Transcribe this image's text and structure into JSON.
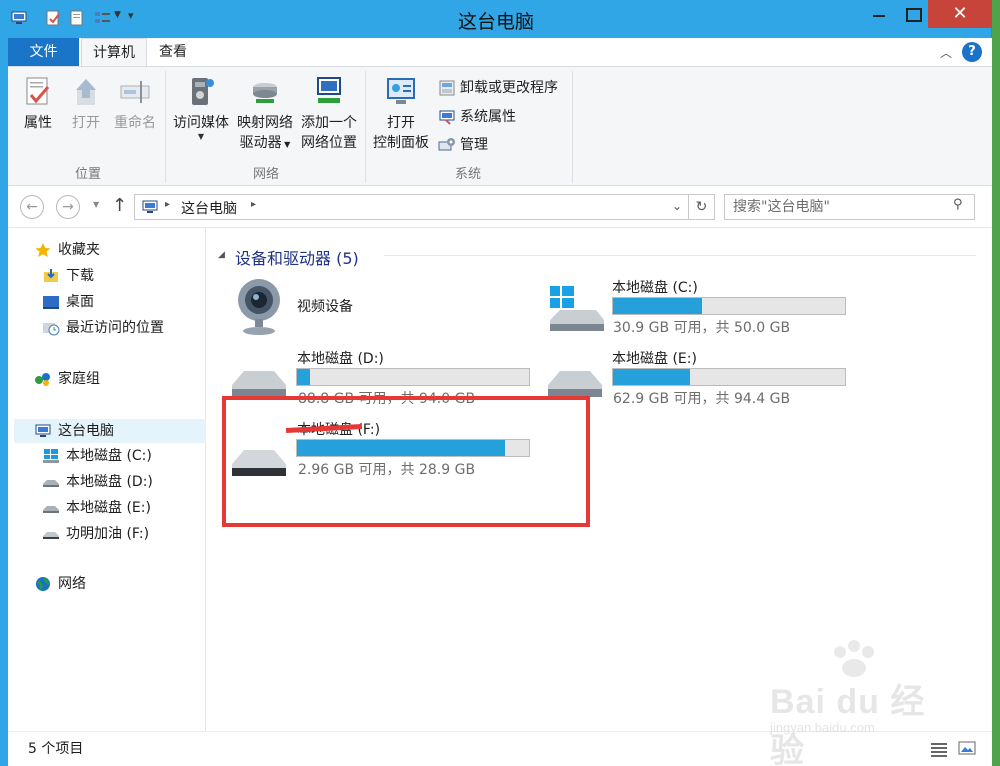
{
  "window": {
    "title": "这台电脑",
    "close_glyph": "✕"
  },
  "tabs": {
    "file": "文件",
    "computer": "计算机",
    "view": "查看"
  },
  "ribbon": {
    "location": {
      "properties": "属性",
      "open": "打开",
      "rename": "重命名",
      "group": "位置"
    },
    "network": {
      "access_media": "访问媒体",
      "map_drive_line1": "映射网络",
      "map_drive_line2": "驱动器",
      "add_location_line1": "添加一个",
      "add_location_line2": "网络位置",
      "group": "网络"
    },
    "system": {
      "open_cp_line1": "打开",
      "open_cp_line2": "控制面板",
      "uninstall": "卸载或更改程序",
      "sys_props": "系统属性",
      "manage": "管理",
      "group": "系统"
    }
  },
  "address": {
    "path": "这台电脑",
    "search_placeholder": "搜索\"这台电脑\""
  },
  "nav": {
    "favorites": "收藏夹",
    "downloads": "下载",
    "desktop": "桌面",
    "recent": "最近访问的位置",
    "homegroup": "家庭组",
    "thispc": "这台电脑",
    "drive_c": "本地磁盘 (C:)",
    "drive_d": "本地磁盘 (D:)",
    "drive_e": "本地磁盘 (E:)",
    "drive_f": "功明加油 (F:)",
    "network": "网络"
  },
  "main": {
    "section": "设备和驱动器 (5)",
    "items": [
      {
        "name": "视频设备"
      },
      {
        "name": "本地磁盘 (C:)",
        "info": "30.9 GB 可用，共 50.0 GB",
        "used_fraction": 0.382
      },
      {
        "name": "本地磁盘 (D:)",
        "info": "88.8 GB 可用，共 94.0 GB",
        "used_fraction": 0.055
      },
      {
        "name": "本地磁盘 (E:)",
        "info": "62.9 GB 可用，共 94.4 GB",
        "used_fraction": 0.334
      },
      {
        "name": "本地磁盘 (F:)",
        "info": "2.96 GB 可用，共 28.9 GB",
        "used_fraction": 0.898
      }
    ]
  },
  "status": {
    "count": "5 个项目"
  },
  "watermark": {
    "brand": "Bai du 经验",
    "url": "jingyan.baidu.com"
  },
  "colors": {
    "titlebar": "#31a6e6",
    "file_tab": "#1a74c8",
    "close": "#c7443a",
    "bar_fill": "#26a0da",
    "highlight": "#e53935"
  }
}
